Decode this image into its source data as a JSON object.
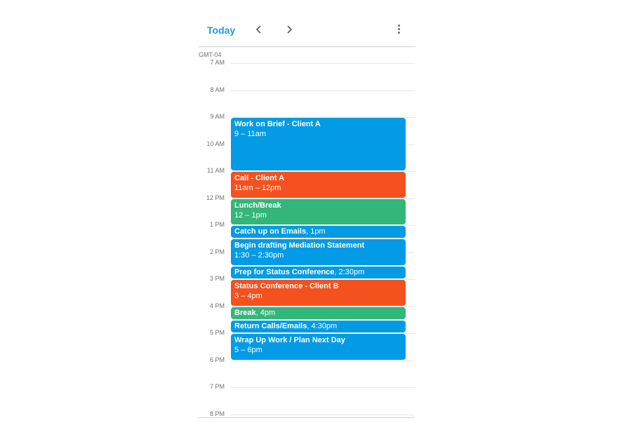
{
  "header": {
    "today_label": "Today",
    "prev_icon": "chevron-left-icon",
    "next_icon": "chevron-right-icon",
    "more_icon": "more-vert-icon"
  },
  "timezone": "GMT-04",
  "hours": [
    "7 AM",
    "8 AM",
    "9 AM",
    "10 AM",
    "11 AM",
    "12 PM",
    "1 PM",
    "2 PM",
    "3 PM",
    "4 PM",
    "5 PM",
    "6 PM",
    "7 PM",
    "8 PM"
  ],
  "colors": {
    "blue": "#039be5",
    "orange": "#f4511e",
    "green": "#33b679",
    "accent": "#1a9be0"
  },
  "events": [
    {
      "title": "Work on Brief - Client A",
      "time": "9 – 11am",
      "start": 9,
      "end": 11,
      "color": "blue",
      "inline": false
    },
    {
      "title": "Call - Client A",
      "time": "11am – 12pm",
      "start": 11,
      "end": 12,
      "color": "orange",
      "inline": false
    },
    {
      "title": "Lunch/Break",
      "time": "12 – 1pm",
      "start": 12,
      "end": 13,
      "color": "green",
      "inline": false
    },
    {
      "title": "Catch up on Emails",
      "time": "1pm",
      "start": 13,
      "end": 13.5,
      "color": "blue",
      "inline": true
    },
    {
      "title": "Begin drafting Mediation Statement",
      "time": "1:30 – 2:30pm",
      "start": 13.5,
      "end": 14.5,
      "color": "blue",
      "inline": false
    },
    {
      "title": "Prep for Status Conference",
      "time": "2:30pm",
      "start": 14.5,
      "end": 15,
      "color": "blue",
      "inline": true
    },
    {
      "title": "Status Conference - Client B",
      "time": "3 – 4pm",
      "start": 15,
      "end": 16,
      "color": "orange",
      "inline": false
    },
    {
      "title": "Break",
      "time": "4pm",
      "start": 16,
      "end": 16.5,
      "color": "green",
      "inline": true
    },
    {
      "title": "Return Calls/Emails",
      "time": "4:30pm",
      "start": 16.5,
      "end": 17,
      "color": "blue",
      "inline": true
    },
    {
      "title": "Wrap Up Work / Plan Next Day",
      "time": "5 – 6pm",
      "start": 17,
      "end": 18,
      "color": "blue",
      "inline": false
    }
  ]
}
